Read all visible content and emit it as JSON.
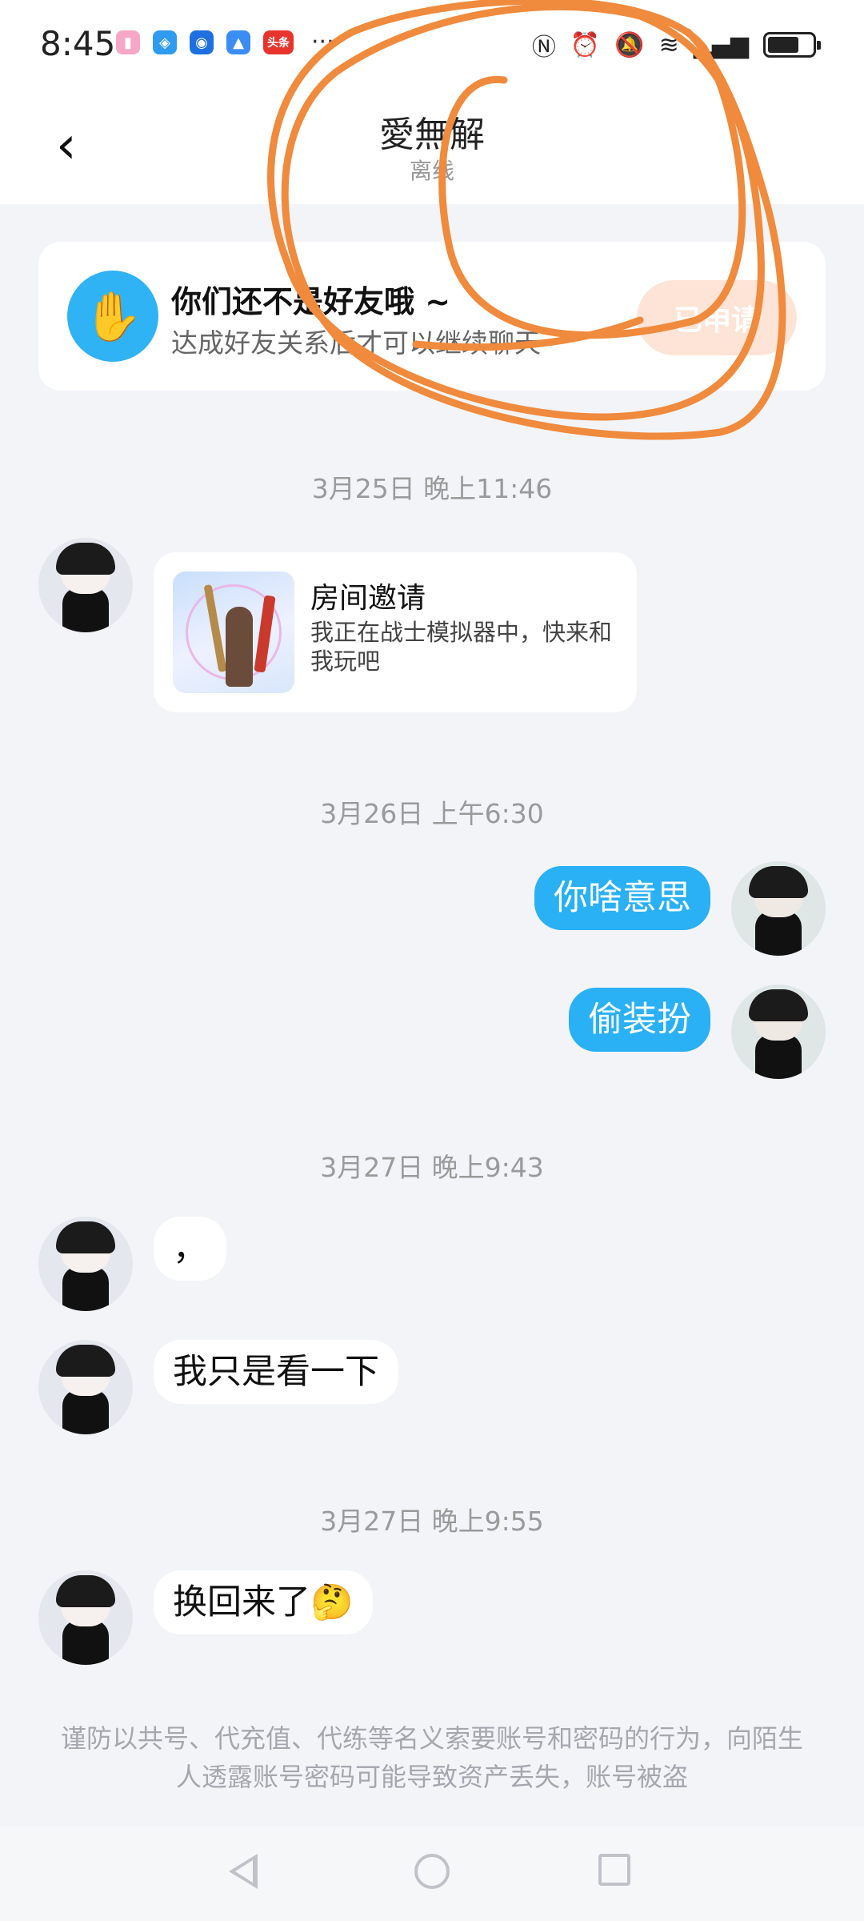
{
  "status_bar": {
    "time": "8:45",
    "more": "···",
    "app_icons": [
      "pink-app-icon",
      "blue-cube-app-icon",
      "bulb-app-icon",
      "graduation-app-icon",
      "toutiao-app-icon"
    ],
    "toutiao_label": "头条",
    "battery_level": 0.7
  },
  "header": {
    "back_icon": "chevron-left-icon",
    "title": "愛無解",
    "status": "离线"
  },
  "friend_card": {
    "title": "你们还不是好友哦 ~",
    "subtitle": "达成好友关系后才可以继续聊天",
    "button": "已申请"
  },
  "messages": {
    "ts1": "3月25日 晚上11:46",
    "invite_title": "房间邀请",
    "invite_text": "我正在战士模拟器中，快来和我玩吧",
    "ts2": "3月26日 上午6:30",
    "out1": "你啥意思",
    "out2": "偷装扮",
    "ts3": "3月27日 晚上9:43",
    "in1": "，",
    "in2": "我只是看一下",
    "ts4": "3月27日 晚上9:55",
    "in3": "换回来了🤔"
  },
  "warning": "谨防以共号、代充值、代练等名义索要账号和密码的行为，向陌生人透露账号密码可能导致资产丢失，账号被盗",
  "colors": {
    "accent": "#29b0f5",
    "applied_button": "#fde4d6",
    "scribble": "#f08a3c"
  }
}
